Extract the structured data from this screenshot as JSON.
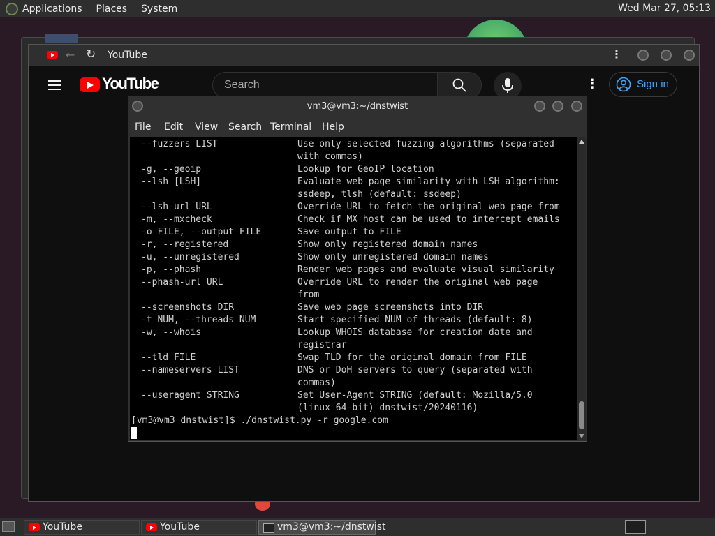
{
  "top_panel": {
    "menus": [
      "Applications",
      "Places",
      "System"
    ],
    "clock": "Wed Mar 27, 05:13"
  },
  "browser": {
    "tab_title": "YouTube",
    "youtube": {
      "logo_text": "YouTube",
      "search_placeholder": "Search",
      "sign_in": "Sign in"
    }
  },
  "terminal": {
    "title": "vm3@vm3:~/dnstwist",
    "menu": [
      "File",
      "Edit",
      "View",
      "Search",
      "Terminal",
      "Help"
    ],
    "lines": [
      {
        "opt": "--fuzzers LIST",
        "desc": "Use only selected fuzzing algorithms (separated"
      },
      {
        "opt": "",
        "desc": "with commas)"
      },
      {
        "opt": "-g, --geoip",
        "desc": "Lookup for GeoIP location"
      },
      {
        "opt": "--lsh [LSH]",
        "desc": "Evaluate web page similarity with LSH algorithm:"
      },
      {
        "opt": "",
        "desc": "ssdeep, tlsh (default: ssdeep)"
      },
      {
        "opt": "--lsh-url URL",
        "desc": "Override URL to fetch the original web page from"
      },
      {
        "opt": "-m, --mxcheck",
        "desc": "Check if MX host can be used to intercept emails"
      },
      {
        "opt": "-o FILE, --output FILE",
        "desc": "Save output to FILE"
      },
      {
        "opt": "-r, --registered",
        "desc": "Show only registered domain names"
      },
      {
        "opt": "-u, --unregistered",
        "desc": "Show only unregistered domain names"
      },
      {
        "opt": "-p, --phash",
        "desc": "Render web pages and evaluate visual similarity"
      },
      {
        "opt": "--phash-url URL",
        "desc": "Override URL to render the original web page"
      },
      {
        "opt": "",
        "desc": "from"
      },
      {
        "opt": "--screenshots DIR",
        "desc": "Save web page screenshots into DIR"
      },
      {
        "opt": "-t NUM, --threads NUM",
        "desc": "Start specified NUM of threads (default: 8)"
      },
      {
        "opt": "-w, --whois",
        "desc": "Lookup WHOIS database for creation date and"
      },
      {
        "opt": "",
        "desc": "registrar"
      },
      {
        "opt": "--tld FILE",
        "desc": "Swap TLD for the original domain from FILE"
      },
      {
        "opt": "--nameservers LIST",
        "desc": "DNS or DoH servers to query (separated with"
      },
      {
        "opt": "",
        "desc": "commas)"
      },
      {
        "opt": "--useragent STRING",
        "desc": "Set User-Agent STRING (default: Mozilla/5.0"
      },
      {
        "opt": "",
        "desc": "(linux 64-bit) dnstwist/20240116)"
      }
    ],
    "prompt": "[vm3@vm3 dnstwist]$ ./dnstwist.py -r google.com"
  },
  "taskbar": {
    "items": [
      "YouTube",
      "YouTube",
      "vm3@vm3:~/dnstwist"
    ]
  }
}
